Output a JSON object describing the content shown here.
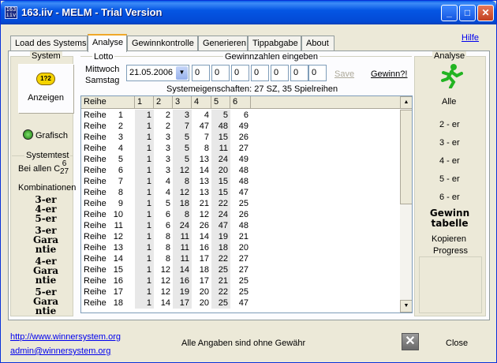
{
  "window": {
    "title": "163.iiv - MELM - Trial Version",
    "app_icon_text": "163 iiv"
  },
  "tabs": [
    "Load des Systems",
    "Analyse",
    "Gewinnkontrolle",
    "Generieren",
    "Tippabgabe",
    "About"
  ],
  "active_tab": "Analyse",
  "hilfe": "Hilfe",
  "system": {
    "label": "System",
    "anzeigen": "Anzeigen",
    "grafisch": "Grafisch",
    "systemtest_label": "Systemtest",
    "bei_allen": "Bei allen C",
    "frac_top": "6",
    "frac_bottom": "27",
    "kombinationen": "Kombinationen",
    "lines": [
      [
        "3-er",
        "4-er",
        "5-er"
      ],
      [
        "3-er",
        "Gara",
        "ntie"
      ],
      [
        "4-er",
        "Gara",
        "ntie"
      ],
      [
        "5-er",
        "Gara",
        "ntie"
      ]
    ]
  },
  "lotto": {
    "label": "Lotto",
    "day1": "Mittwoch",
    "day2": "Samstag",
    "gz_label": "Gewinnzahlen eingeben",
    "date": "21.05.2006",
    "numbers": [
      "0",
      "0",
      "0",
      "0",
      "0",
      "0",
      "0"
    ],
    "save": "Save",
    "gewinn_q": "Gewinn?!"
  },
  "systemeigenschaften": "Systemeigenschaften: 27 SZ, 35 Spielreihen",
  "table": {
    "headers": [
      "Reihe",
      "1",
      "2",
      "3",
      "4",
      "5",
      "6"
    ],
    "row_label": "Reihe",
    "rows": [
      [
        "1",
        "1",
        "2",
        "3",
        "4",
        "5",
        "6"
      ],
      [
        "2",
        "1",
        "2",
        "7",
        "47",
        "48",
        "49"
      ],
      [
        "3",
        "1",
        "3",
        "5",
        "7",
        "15",
        "26"
      ],
      [
        "4",
        "1",
        "3",
        "5",
        "8",
        "11",
        "27"
      ],
      [
        "5",
        "1",
        "3",
        "5",
        "13",
        "24",
        "49"
      ],
      [
        "6",
        "1",
        "3",
        "12",
        "14",
        "20",
        "48"
      ],
      [
        "7",
        "1",
        "4",
        "8",
        "13",
        "15",
        "48"
      ],
      [
        "8",
        "1",
        "4",
        "12",
        "13",
        "15",
        "47"
      ],
      [
        "9",
        "1",
        "5",
        "18",
        "21",
        "22",
        "25"
      ],
      [
        "10",
        "1",
        "6",
        "8",
        "12",
        "24",
        "26"
      ],
      [
        "11",
        "1",
        "6",
        "24",
        "26",
        "47",
        "48"
      ],
      [
        "12",
        "1",
        "8",
        "11",
        "14",
        "19",
        "21"
      ],
      [
        "13",
        "1",
        "8",
        "11",
        "16",
        "18",
        "20"
      ],
      [
        "14",
        "1",
        "8",
        "11",
        "17",
        "22",
        "27"
      ],
      [
        "15",
        "1",
        "12",
        "14",
        "18",
        "25",
        "27"
      ],
      [
        "16",
        "1",
        "12",
        "16",
        "17",
        "21",
        "25"
      ],
      [
        "17",
        "1",
        "12",
        "19",
        "20",
        "22",
        "25"
      ],
      [
        "18",
        "1",
        "14",
        "17",
        "20",
        "25",
        "47"
      ]
    ]
  },
  "analyse": {
    "label": "Analyse",
    "alle": "Alle",
    "items": [
      "2 - er",
      "3 - er",
      "4 - er",
      "5 - er",
      "6 - er"
    ],
    "gewinn_line1": "Gewinn",
    "gewinn_line2": "tabelle",
    "kopieren": "Kopieren",
    "progress": "Progress"
  },
  "footer": {
    "url": "http://www.winnersystem.org",
    "email": "admin@winnersystem.org",
    "disclaimer": "Alle Angaben sind ohne Gewähr",
    "close": "Close"
  }
}
